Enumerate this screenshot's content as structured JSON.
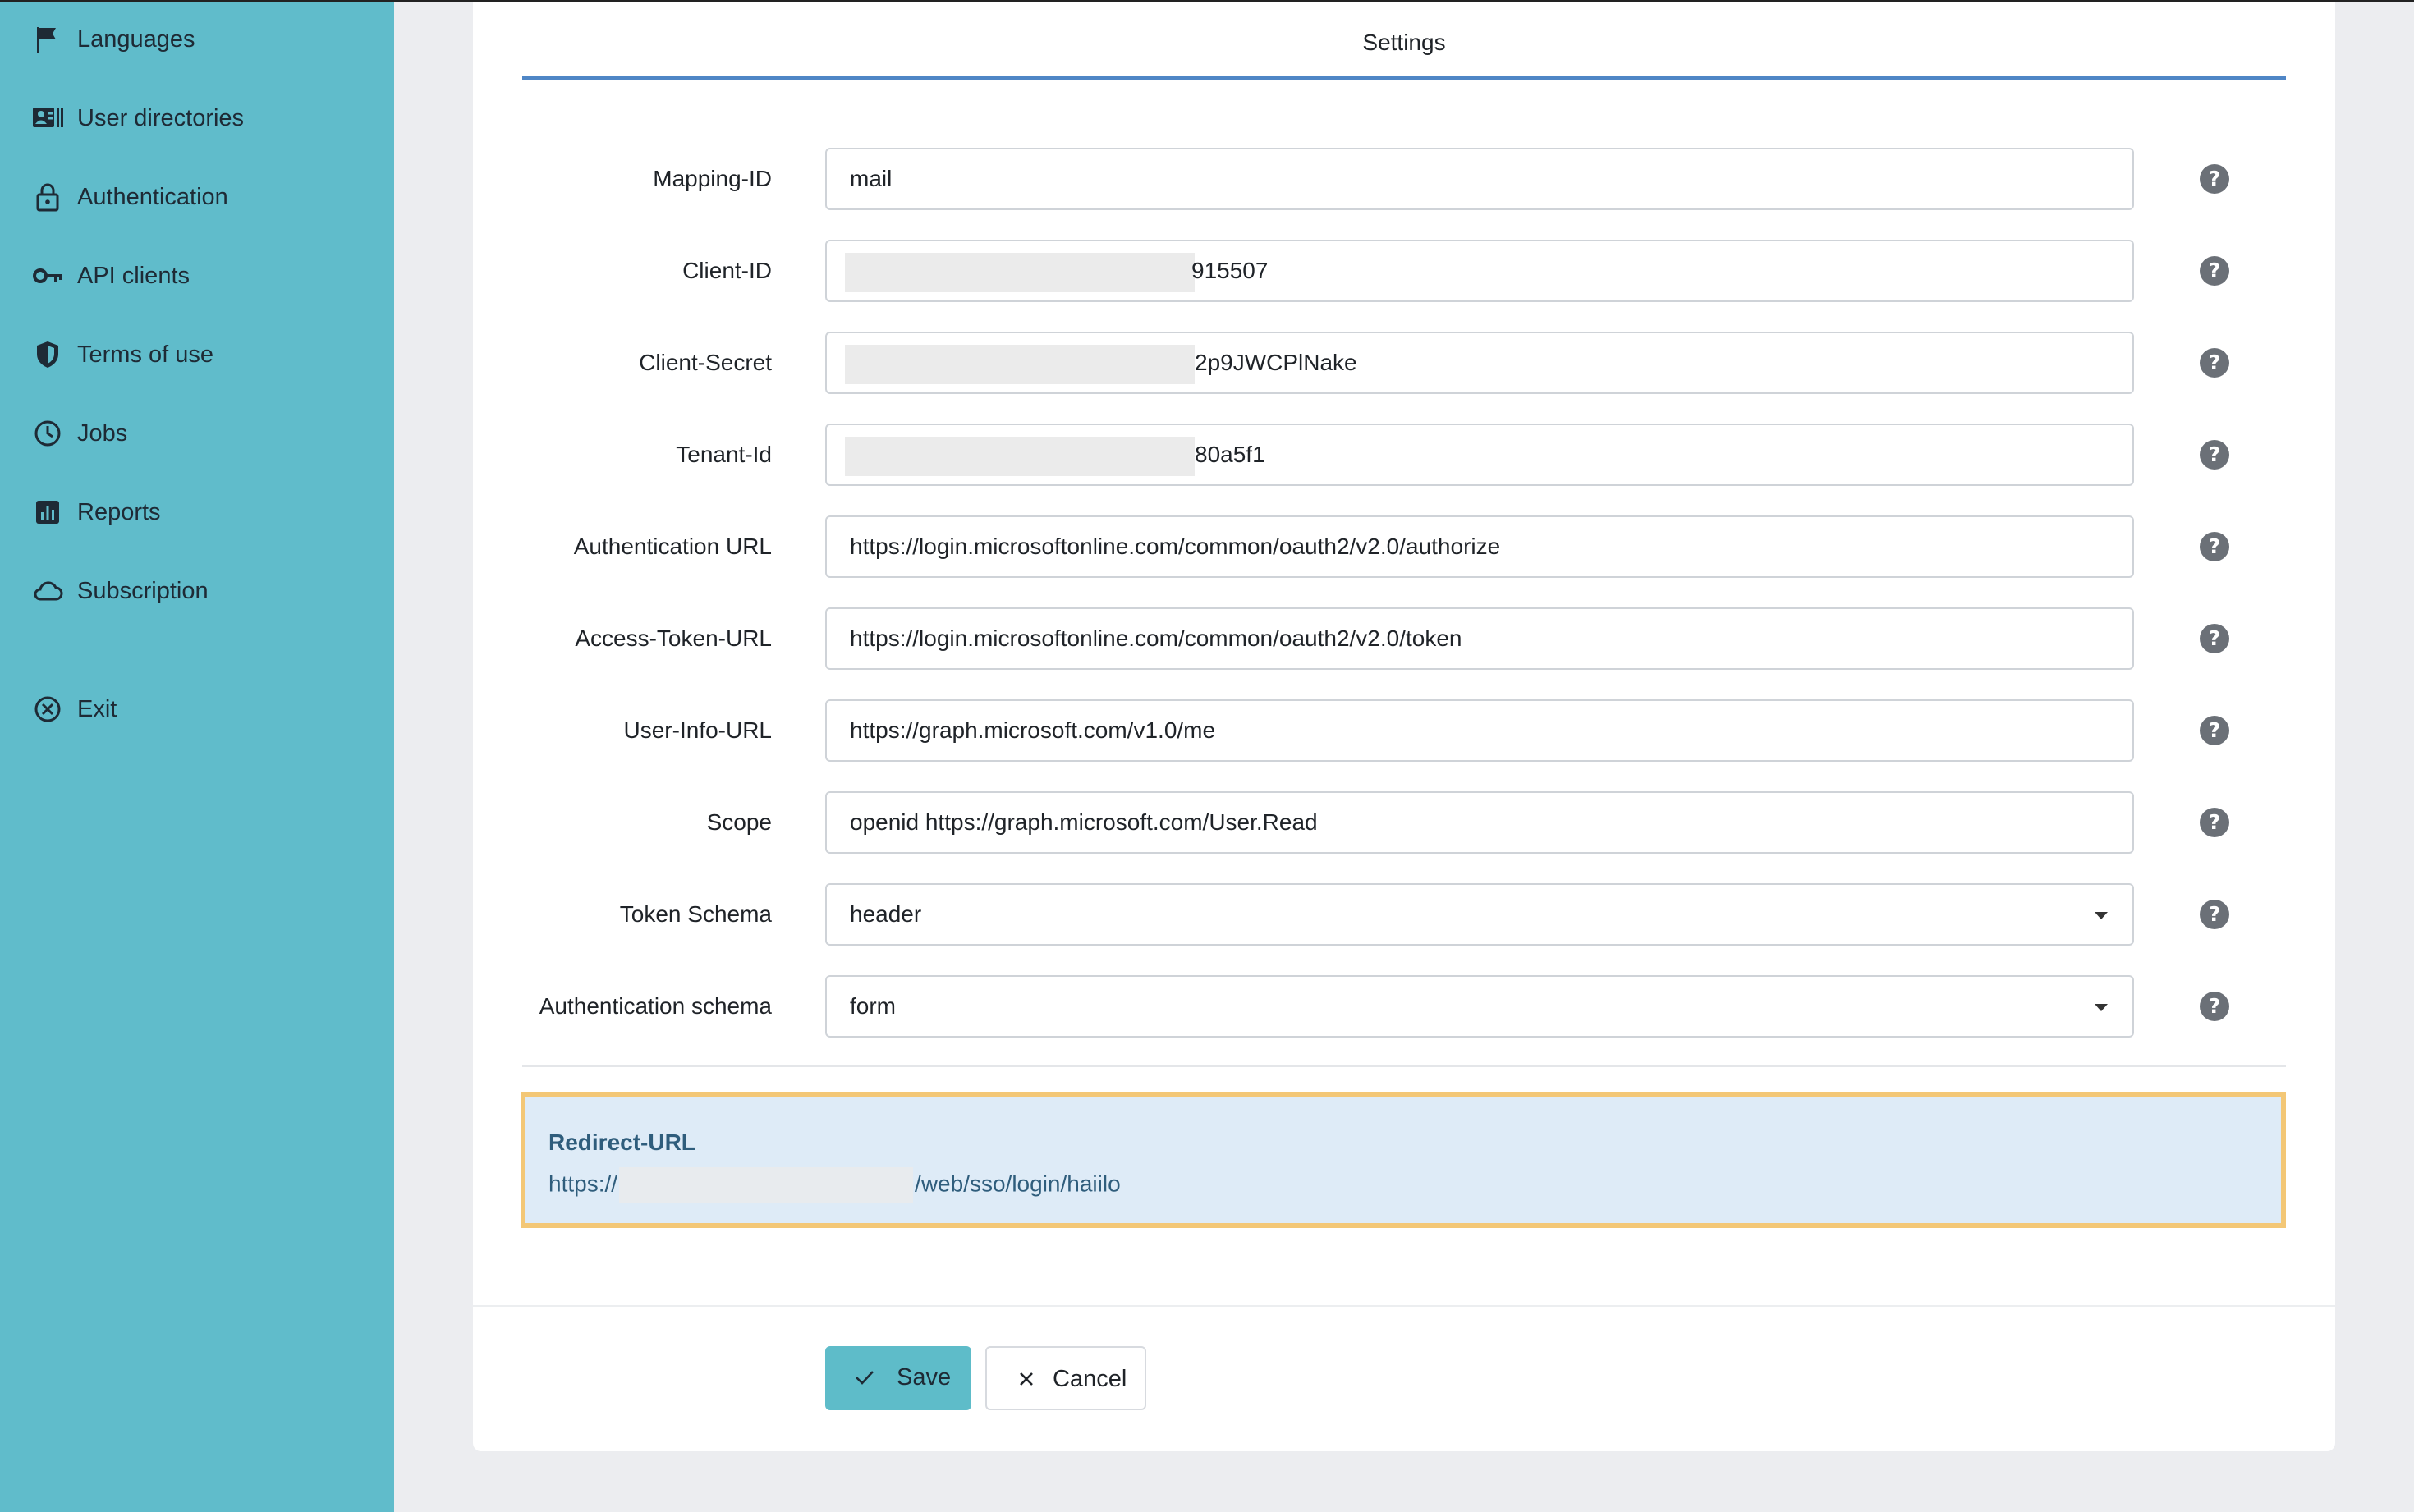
{
  "sidebar": {
    "items": [
      {
        "label": "Languages",
        "icon": "flag-icon"
      },
      {
        "label": "User directories",
        "icon": "address-book-icon"
      },
      {
        "label": "Authentication",
        "icon": "lock-icon"
      },
      {
        "label": "API clients",
        "icon": "key-icon"
      },
      {
        "label": "Terms of use",
        "icon": "shield-icon"
      },
      {
        "label": "Jobs",
        "icon": "clock-icon"
      },
      {
        "label": "Reports",
        "icon": "bar-chart-icon"
      },
      {
        "label": "Subscription",
        "icon": "cloud-icon"
      },
      {
        "label": "Exit",
        "icon": "circle-x-icon"
      }
    ]
  },
  "tab": {
    "title": "Settings"
  },
  "form": {
    "fields": [
      {
        "label": "Mapping-ID",
        "value": "mail"
      },
      {
        "label": "Client-ID",
        "value": "915507"
      },
      {
        "label": "Client-Secret",
        "value": "2p9JWCPlNake"
      },
      {
        "label": "Tenant-Id",
        "value": "80a5f1"
      },
      {
        "label": "Authentication URL",
        "value": "https://login.microsoftonline.com/common/oauth2/v2.0/authorize"
      },
      {
        "label": "Access-Token-URL",
        "value": "https://login.microsoftonline.com/common/oauth2/v2.0/token"
      },
      {
        "label": "User-Info-URL",
        "value": "https://graph.microsoft.com/v1.0/me"
      },
      {
        "label": "Scope",
        "value": "openid https://graph.microsoft.com/User.Read"
      },
      {
        "label": "Token Schema",
        "value": "header"
      },
      {
        "label": "Authentication schema",
        "value": "form"
      }
    ],
    "help_glyph": "?"
  },
  "redirect": {
    "title": "Redirect-URL",
    "url_prefix": "https://",
    "url_suffix": "/web/sso/login/haiilo"
  },
  "actions": {
    "save_label": "Save",
    "cancel_label": "Cancel"
  },
  "colors": {
    "sidebar": "#60bccb",
    "accent": "#4f86c6",
    "save_button": "#5ebcc9",
    "highlight_border": "#f3c776",
    "info_bg": "#deebf7"
  }
}
